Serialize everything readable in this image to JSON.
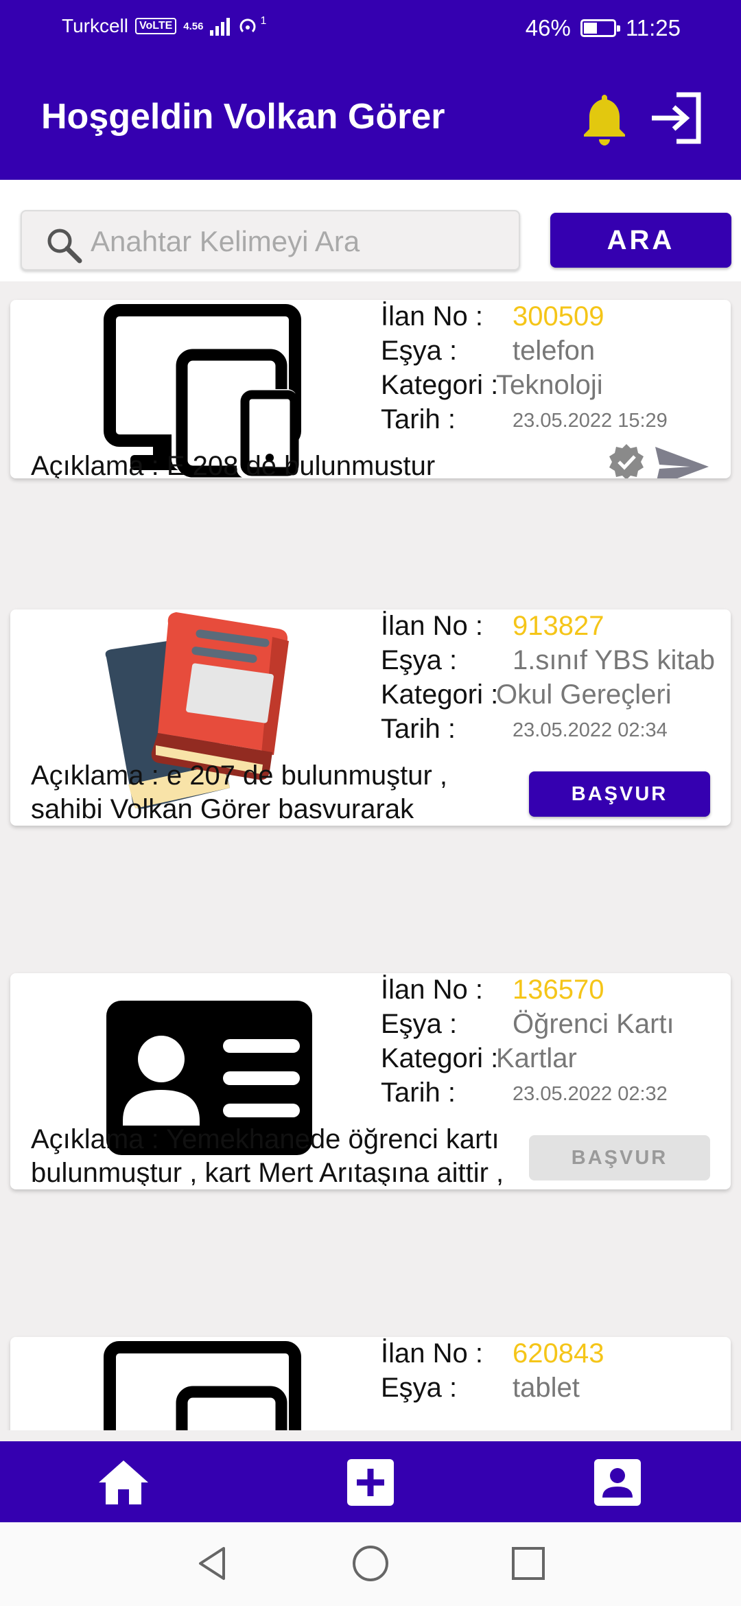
{
  "status_bar": {
    "carrier": "Turkcell",
    "volte": "VoLTE",
    "network": "4.56",
    "hotspot_badge": "1",
    "battery_percent": "46%",
    "battery_level": 0.46,
    "time": "11:25"
  },
  "header": {
    "title": "Hoşgeldin Volkan Görer",
    "bell_icon": "bell-icon",
    "logout_icon": "logout-icon",
    "accent_color": "#3500b0",
    "bell_color": "#e2c80f"
  },
  "search": {
    "placeholder": "Anahtar Kelimeyi Ara",
    "value": "",
    "button_label": "ARA"
  },
  "labels": {
    "ilan_no": "İlan No :",
    "esya": "Eşya :",
    "kategori": "Kategori :",
    "tarih": "Tarih :"
  },
  "listings": [
    {
      "image_icon": "devices-icon",
      "ilan_no": "300509",
      "esya": "telefon",
      "kategori": "Teknoloji",
      "tarih": "23.05.2022 15:29",
      "aciklama": "Açıklama : E 208 de bulunmustur",
      "action": "verified-and-send"
    },
    {
      "image_icon": "books-icon",
      "ilan_no": "913827",
      "esya": "1.sınıf YBS kitab",
      "kategori": "Okul Gereçleri",
      "tarih": "23.05.2022 02:34",
      "aciklama": "Açıklama : e 207 de bulunmuştur , sahibi Volkan Görer basvurarak benimle iletisime geçebilir.",
      "button_label": "BAŞVUR",
      "button_state": "active"
    },
    {
      "image_icon": "id-card-icon",
      "ilan_no": "136570",
      "esya": "Öğrenci Kartı",
      "kategori": "Kartlar",
      "tarih": "23.05.2022 02:32",
      "aciklama": "Açıklama : Yemekhanede öğrenci kartı bulunmuştur , kart Mert Arıtaşına aittir , yemekhaneden kartını alabilir",
      "button_label": "BAŞVUR",
      "button_state": "disabled"
    },
    {
      "image_icon": "devices-icon",
      "ilan_no": "620843",
      "esya": "tablet"
    }
  ],
  "bottom_nav": {
    "items": [
      "home-icon",
      "add-icon",
      "profile-icon"
    ]
  },
  "system_nav": {
    "items": [
      "back-icon",
      "home-circle-icon",
      "recents-icon"
    ]
  }
}
